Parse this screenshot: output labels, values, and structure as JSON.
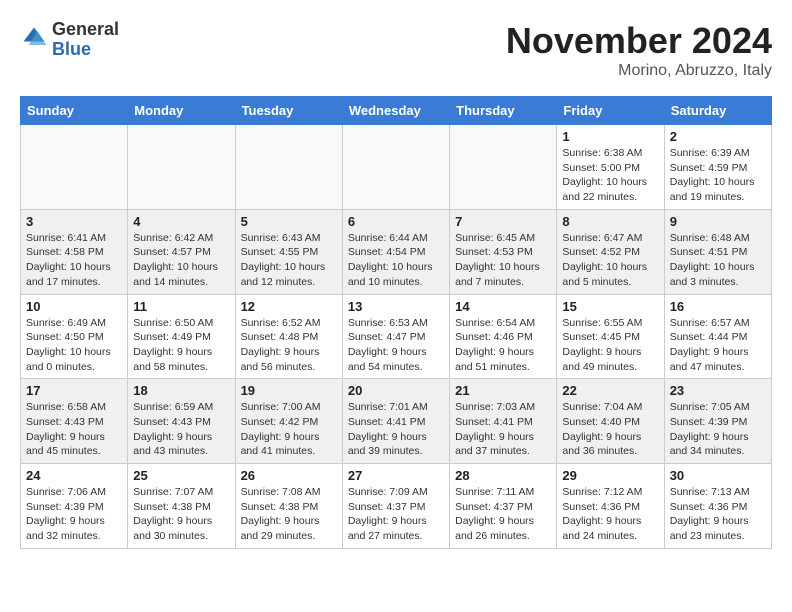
{
  "header": {
    "logo_general": "General",
    "logo_blue": "Blue",
    "month_title": "November 2024",
    "location": "Morino, Abruzzo, Italy"
  },
  "days_of_week": [
    "Sunday",
    "Monday",
    "Tuesday",
    "Wednesday",
    "Thursday",
    "Friday",
    "Saturday"
  ],
  "weeks": [
    [
      {
        "day": "",
        "info": ""
      },
      {
        "day": "",
        "info": ""
      },
      {
        "day": "",
        "info": ""
      },
      {
        "day": "",
        "info": ""
      },
      {
        "day": "",
        "info": ""
      },
      {
        "day": "1",
        "info": "Sunrise: 6:38 AM\nSunset: 5:00 PM\nDaylight: 10 hours\nand 22 minutes."
      },
      {
        "day": "2",
        "info": "Sunrise: 6:39 AM\nSunset: 4:59 PM\nDaylight: 10 hours\nand 19 minutes."
      }
    ],
    [
      {
        "day": "3",
        "info": "Sunrise: 6:41 AM\nSunset: 4:58 PM\nDaylight: 10 hours\nand 17 minutes."
      },
      {
        "day": "4",
        "info": "Sunrise: 6:42 AM\nSunset: 4:57 PM\nDaylight: 10 hours\nand 14 minutes."
      },
      {
        "day": "5",
        "info": "Sunrise: 6:43 AM\nSunset: 4:55 PM\nDaylight: 10 hours\nand 12 minutes."
      },
      {
        "day": "6",
        "info": "Sunrise: 6:44 AM\nSunset: 4:54 PM\nDaylight: 10 hours\nand 10 minutes."
      },
      {
        "day": "7",
        "info": "Sunrise: 6:45 AM\nSunset: 4:53 PM\nDaylight: 10 hours\nand 7 minutes."
      },
      {
        "day": "8",
        "info": "Sunrise: 6:47 AM\nSunset: 4:52 PM\nDaylight: 10 hours\nand 5 minutes."
      },
      {
        "day": "9",
        "info": "Sunrise: 6:48 AM\nSunset: 4:51 PM\nDaylight: 10 hours\nand 3 minutes."
      }
    ],
    [
      {
        "day": "10",
        "info": "Sunrise: 6:49 AM\nSunset: 4:50 PM\nDaylight: 10 hours\nand 0 minutes."
      },
      {
        "day": "11",
        "info": "Sunrise: 6:50 AM\nSunset: 4:49 PM\nDaylight: 9 hours\nand 58 minutes."
      },
      {
        "day": "12",
        "info": "Sunrise: 6:52 AM\nSunset: 4:48 PM\nDaylight: 9 hours\nand 56 minutes."
      },
      {
        "day": "13",
        "info": "Sunrise: 6:53 AM\nSunset: 4:47 PM\nDaylight: 9 hours\nand 54 minutes."
      },
      {
        "day": "14",
        "info": "Sunrise: 6:54 AM\nSunset: 4:46 PM\nDaylight: 9 hours\nand 51 minutes."
      },
      {
        "day": "15",
        "info": "Sunrise: 6:55 AM\nSunset: 4:45 PM\nDaylight: 9 hours\nand 49 minutes."
      },
      {
        "day": "16",
        "info": "Sunrise: 6:57 AM\nSunset: 4:44 PM\nDaylight: 9 hours\nand 47 minutes."
      }
    ],
    [
      {
        "day": "17",
        "info": "Sunrise: 6:58 AM\nSunset: 4:43 PM\nDaylight: 9 hours\nand 45 minutes."
      },
      {
        "day": "18",
        "info": "Sunrise: 6:59 AM\nSunset: 4:43 PM\nDaylight: 9 hours\nand 43 minutes."
      },
      {
        "day": "19",
        "info": "Sunrise: 7:00 AM\nSunset: 4:42 PM\nDaylight: 9 hours\nand 41 minutes."
      },
      {
        "day": "20",
        "info": "Sunrise: 7:01 AM\nSunset: 4:41 PM\nDaylight: 9 hours\nand 39 minutes."
      },
      {
        "day": "21",
        "info": "Sunrise: 7:03 AM\nSunset: 4:41 PM\nDaylight: 9 hours\nand 37 minutes."
      },
      {
        "day": "22",
        "info": "Sunrise: 7:04 AM\nSunset: 4:40 PM\nDaylight: 9 hours\nand 36 minutes."
      },
      {
        "day": "23",
        "info": "Sunrise: 7:05 AM\nSunset: 4:39 PM\nDaylight: 9 hours\nand 34 minutes."
      }
    ],
    [
      {
        "day": "24",
        "info": "Sunrise: 7:06 AM\nSunset: 4:39 PM\nDaylight: 9 hours\nand 32 minutes."
      },
      {
        "day": "25",
        "info": "Sunrise: 7:07 AM\nSunset: 4:38 PM\nDaylight: 9 hours\nand 30 minutes."
      },
      {
        "day": "26",
        "info": "Sunrise: 7:08 AM\nSunset: 4:38 PM\nDaylight: 9 hours\nand 29 minutes."
      },
      {
        "day": "27",
        "info": "Sunrise: 7:09 AM\nSunset: 4:37 PM\nDaylight: 9 hours\nand 27 minutes."
      },
      {
        "day": "28",
        "info": "Sunrise: 7:11 AM\nSunset: 4:37 PM\nDaylight: 9 hours\nand 26 minutes."
      },
      {
        "day": "29",
        "info": "Sunrise: 7:12 AM\nSunset: 4:36 PM\nDaylight: 9 hours\nand 24 minutes."
      },
      {
        "day": "30",
        "info": "Sunrise: 7:13 AM\nSunset: 4:36 PM\nDaylight: 9 hours\nand 23 minutes."
      }
    ]
  ]
}
